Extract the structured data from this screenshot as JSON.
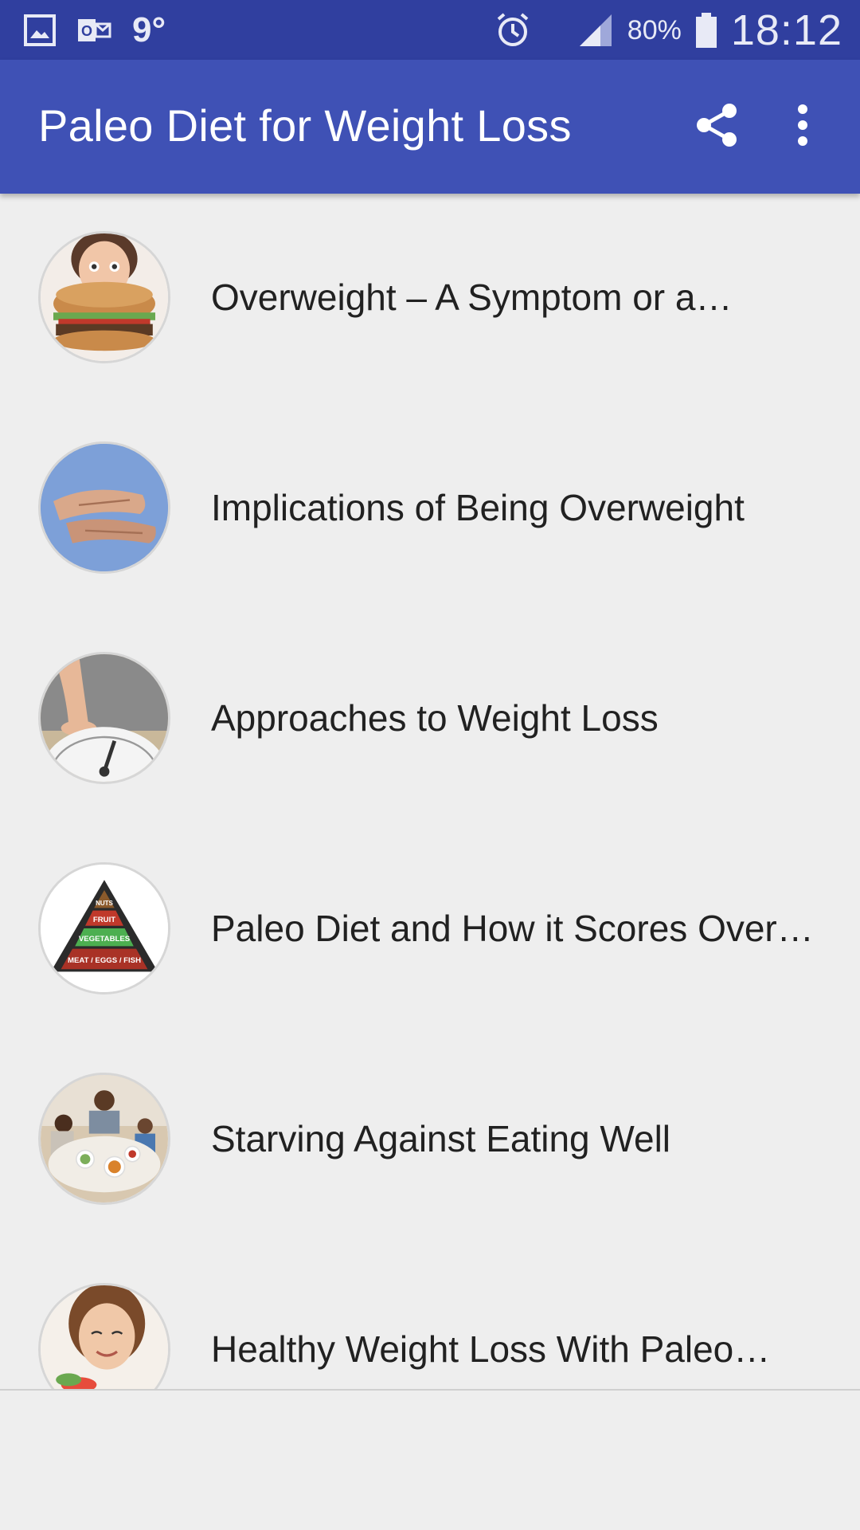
{
  "status_bar": {
    "temperature": "9°",
    "battery_percent": "80%",
    "time": "18:12",
    "icons": [
      "gallery-icon",
      "outlook-icon",
      "alarm-icon",
      "signal-icon",
      "battery-icon"
    ]
  },
  "app_bar": {
    "title": "Paleo Diet for Weight Loss",
    "actions": [
      "share-icon",
      "more-vert-icon"
    ]
  },
  "colors": {
    "status_bar": "#303f9f",
    "app_bar": "#3f51b5",
    "background": "#eeeeee",
    "text": "#212121"
  },
  "list": {
    "items": [
      {
        "label": "Overweight – A Symptom or a…",
        "thumbnail": "burger-eater-image"
      },
      {
        "label": "Implications of Being Overweight",
        "thumbnail": "hands-on-belly-image"
      },
      {
        "label": "Approaches to Weight Loss",
        "thumbnail": "scale-image"
      },
      {
        "label": "Paleo Diet and How it Scores Over…",
        "thumbnail": "food-pyramid-image",
        "pyramid_text": [
          "NUTS",
          "FRUIT",
          "VEGETABLES",
          "MEAT / EGGS / FISH"
        ]
      },
      {
        "label": "Starving Against Eating Well",
        "thumbnail": "family-dinner-image"
      },
      {
        "label": "Healthy Weight Loss With Paleo…",
        "thumbnail": "woman-eating-image"
      }
    ]
  }
}
